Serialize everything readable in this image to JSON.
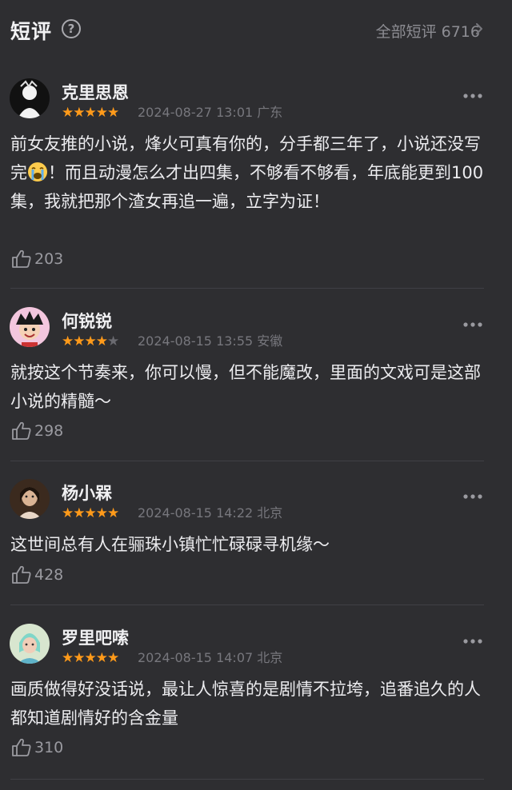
{
  "header": {
    "title": "短评",
    "help_icon": "?",
    "all_link": "全部短评 6716"
  },
  "colors": {
    "background": "#2e2e31",
    "star": "#ff9a1a",
    "star_empty": "#6a6a70",
    "meta": "#77777d"
  },
  "reviews": [
    {
      "username": "克里思恩",
      "rating": 5,
      "stars_text_on": "★★★★★",
      "stars_text_off": "",
      "date_location": "2024-08-27 13:01 广东",
      "text_a": "前女友推的小说，烽火可真有你的，分手都三年了，小说还没写完",
      "emoji": "loudly-crying-face",
      "text_b": "！而且动漫怎么才出四集，不够看不够看，年底能更到100集，我就把那个渣女再追一遍，立字为证！",
      "likes": "203"
    },
    {
      "username": "何锐锐",
      "rating": 4,
      "stars_text_on": "★★★★",
      "stars_text_off": "★",
      "date_location": "2024-08-15 13:55 安徽",
      "text": "就按这个节奏来，你可以慢，但不能魔改，里面的文戏可是这部小说的精髓～",
      "likes": "298"
    },
    {
      "username": "杨小槑",
      "rating": 5,
      "stars_text_on": "★★★★★",
      "stars_text_off": "",
      "date_location": "2024-08-15 14:22 北京",
      "text": "这世间总有人在骊珠小镇忙忙碌碌寻机缘～",
      "likes": "428"
    },
    {
      "username": "罗里吧嗦",
      "rating": 5,
      "stars_text_on": "★★★★★",
      "stars_text_off": "",
      "date_location": "2024-08-15 14:07 北京",
      "text": "画质做得好没话说，最让人惊喜的是剧情不拉垮，追番追久的人都知道剧情好的含金量",
      "likes": "310"
    }
  ]
}
